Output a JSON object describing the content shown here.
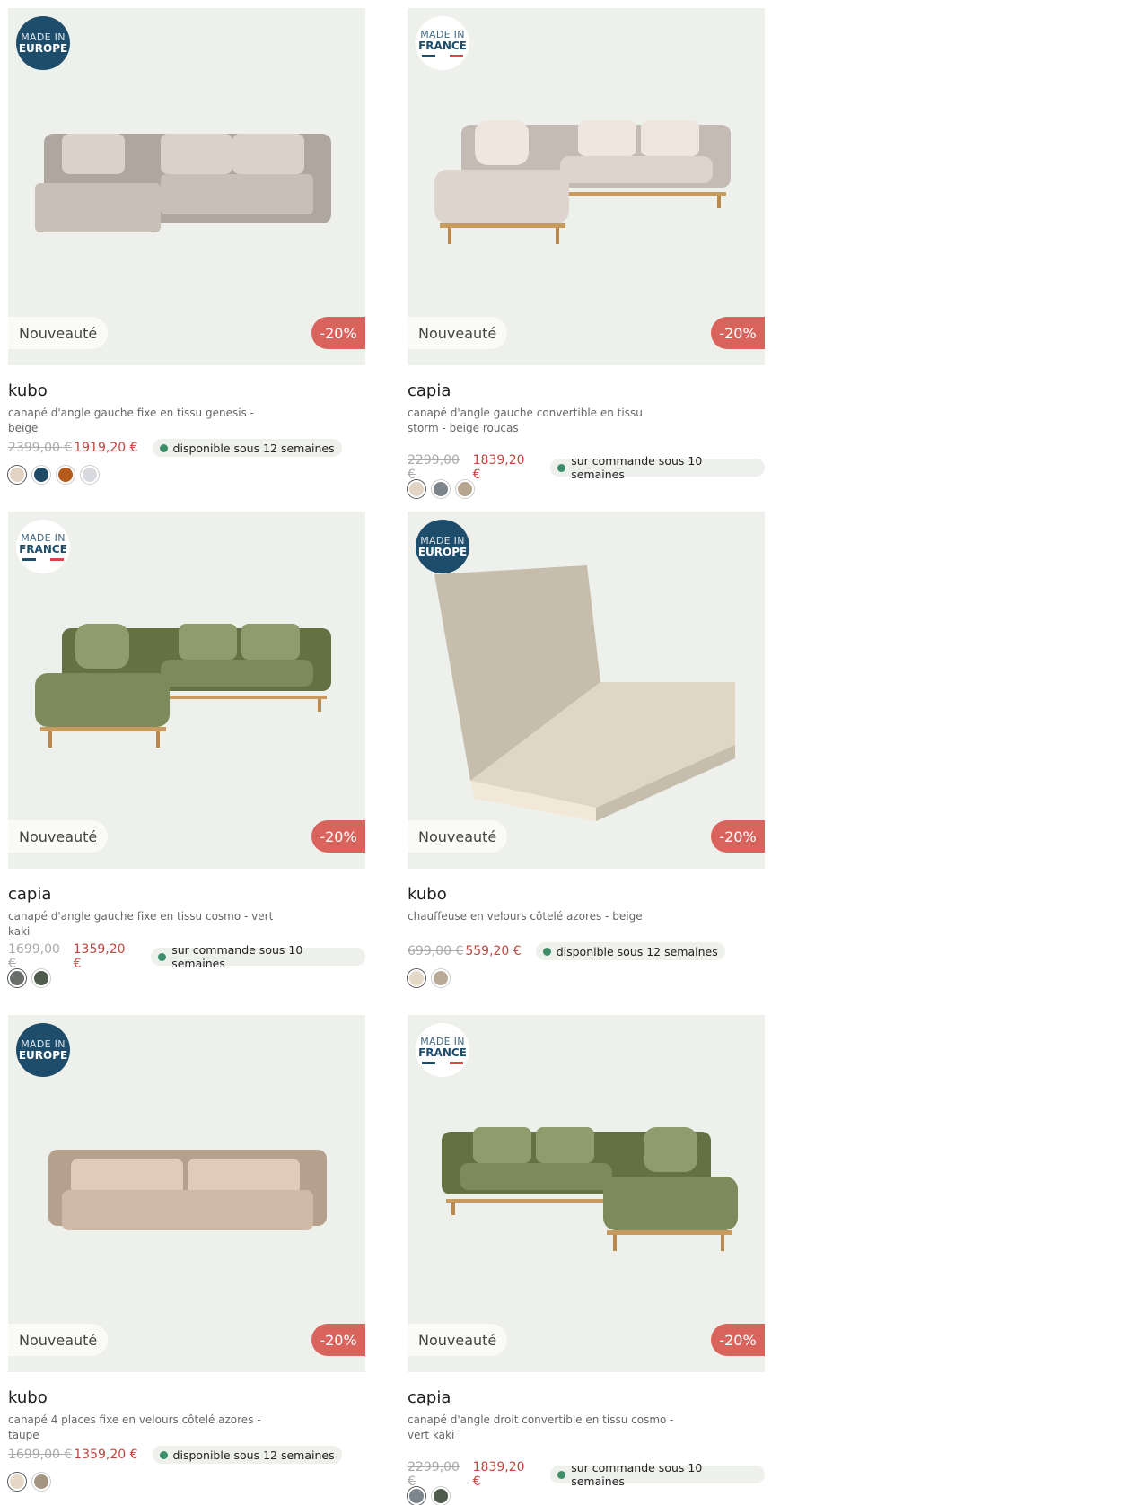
{
  "products": [
    {
      "origin": {
        "line1": "MADE IN",
        "line2": "EUROPE",
        "variant": "europe"
      },
      "new_label": "Nouveauté",
      "discount": "-20%",
      "name": "kubo",
      "description": "canapé d'angle gauche fixe en tissu genesis - beige",
      "old_price": "2399,00 €",
      "price": "1919,20 €",
      "availability": "disponible sous 12 semaines",
      "swatches": [
        "#e2d3c5",
        "#1f4a66",
        "#b65a1a",
        "#d8dadf"
      ],
      "sofa": {
        "style": "modular",
        "color": "#c8c0b8"
      }
    },
    {
      "origin": {
        "line1": "MADE IN",
        "line2": "FRANCE",
        "variant": "france"
      },
      "new_label": "Nouveauté",
      "discount": "-20%",
      "name": "capia",
      "description": "canapé d'angle gauche convertible en tissu storm - beige roucas",
      "old_price": "2299,00 €",
      "price": "1839,20 €",
      "availability": "sur commande sous 10 semaines",
      "swatches": [
        "#e3d5c3",
        "#7d858c",
        "#b6a690"
      ],
      "sofa": {
        "style": "legs",
        "color": "#ddd5cd"
      }
    },
    {
      "origin": {
        "line1": "MADE IN",
        "line2": "FRANCE",
        "variant": "france"
      },
      "new_label": "Nouveauté",
      "discount": "-20%",
      "name": "capia",
      "description": "canapé d'angle gauche fixe en tissu cosmo - vert kaki",
      "old_price": "1699,00 €",
      "price": "1359,20 €",
      "availability": "sur commande sous 10 semaines",
      "swatches": [
        "#6a6e6b",
        "#4f5c4c"
      ],
      "sofa": {
        "style": "legs",
        "color": "#7d8a5c"
      }
    },
    {
      "origin": {
        "line1": "MADE IN",
        "line2": "EUROPE",
        "variant": "europe"
      },
      "new_label": "Nouveauté",
      "discount": "-20%",
      "name": "kubo",
      "description": "chauffeuse en velours côtelé azores - beige",
      "old_price": "699,00 €",
      "price": "559,20 €",
      "availability": "disponible sous 12 semaines",
      "swatches": [
        "#e6d8c6",
        "#b9aa98"
      ],
      "sofa": {
        "style": "chair",
        "color": "#e0d6c6"
      }
    },
    {
      "origin": {
        "line1": "MADE IN",
        "line2": "EUROPE",
        "variant": "europe"
      },
      "new_label": "Nouveauté",
      "discount": "-20%",
      "name": "kubo",
      "description": "canapé 4 places fixe en velours côtelé azores - taupe",
      "old_price": "1699,00 €",
      "price": "1359,20 €",
      "availability": "disponible sous 12 semaines",
      "swatches": [
        "#e6d8c6",
        "#a49580"
      ],
      "sofa": {
        "style": "straight",
        "color": "#cdb9a5"
      }
    },
    {
      "origin": {
        "line1": "MADE IN",
        "line2": "FRANCE",
        "variant": "france"
      },
      "new_label": "Nouveauté",
      "discount": "-20%",
      "name": "capia",
      "description": "canapé d'angle droit convertible en tissu cosmo - vert kaki",
      "old_price": "2299,00 €",
      "price": "1839,20 €",
      "availability": "sur commande sous 10 semaines",
      "swatches": [
        "#7d858c",
        "#4f5c4c"
      ],
      "sofa": {
        "style": "legs-right",
        "color": "#7d8a5c"
      }
    }
  ]
}
